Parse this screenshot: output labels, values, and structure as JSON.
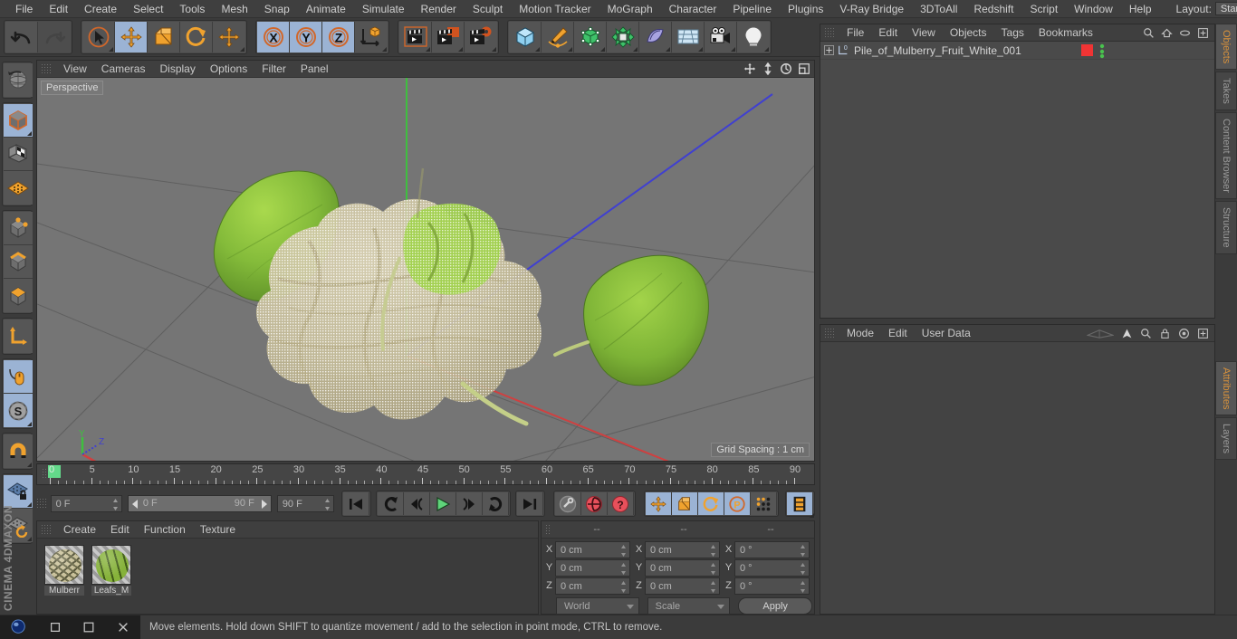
{
  "menubar": {
    "items": [
      "File",
      "Edit",
      "Create",
      "Select",
      "Tools",
      "Mesh",
      "Snap",
      "Animate",
      "Simulate",
      "Render",
      "Sculpt",
      "Motion Tracker",
      "MoGraph",
      "Character",
      "Pipeline",
      "Plugins",
      "V-Ray Bridge",
      "3DToAll",
      "Redshift",
      "Script",
      "Window",
      "Help"
    ],
    "layout_label": "Layout:",
    "layout_value": "Startup"
  },
  "toolbar": {
    "groups": [
      {
        "name": "undo-redo",
        "buttons": [
          {
            "icon": "undo-icon",
            "label": "Undo",
            "state": "normal"
          },
          {
            "icon": "redo-icon",
            "label": "Redo",
            "state": "disabled"
          }
        ]
      },
      {
        "name": "transform",
        "buttons": [
          {
            "icon": "select-cursor-icon",
            "label": "Live Selection",
            "state": "normal"
          },
          {
            "icon": "move-icon",
            "label": "Move",
            "state": "active"
          },
          {
            "icon": "scale-icon",
            "label": "Scale",
            "state": "normal"
          },
          {
            "icon": "rotate-icon",
            "label": "Rotate",
            "state": "normal"
          },
          {
            "icon": "move-alt-icon",
            "label": "Move Alt",
            "state": "normal"
          }
        ]
      },
      {
        "name": "axis-lock",
        "buttons": [
          {
            "icon": "axis-x-icon",
            "label": "X Axis",
            "state": "active"
          },
          {
            "icon": "axis-y-icon",
            "label": "Y Axis",
            "state": "active"
          },
          {
            "icon": "axis-z-icon",
            "label": "Z Axis",
            "state": "active"
          },
          {
            "icon": "world-coord-icon",
            "label": "World/Object Coordinates",
            "state": "normal"
          }
        ]
      },
      {
        "name": "render",
        "buttons": [
          {
            "icon": "render-view-icon",
            "label": "Render View",
            "state": "normal"
          },
          {
            "icon": "render-picture-viewer-icon",
            "label": "Render to Picture Viewer",
            "state": "normal"
          },
          {
            "icon": "render-settings-icon",
            "label": "Edit Render Settings",
            "state": "normal"
          }
        ]
      },
      {
        "name": "create",
        "buttons": [
          {
            "icon": "cube-primitive-icon",
            "label": "Add Cube Object",
            "state": "normal"
          },
          {
            "icon": "pen-spline-icon",
            "label": "Add Spline",
            "state": "normal"
          },
          {
            "icon": "generator-icon",
            "label": "Add Generator",
            "state": "normal"
          },
          {
            "icon": "deformer-icon",
            "label": "Add Deformer",
            "state": "normal"
          },
          {
            "icon": "scene-object-icon",
            "label": "Add Scene Object",
            "state": "normal"
          },
          {
            "icon": "environment-icon",
            "label": "Add Environment",
            "state": "normal"
          },
          {
            "icon": "camera-icon",
            "label": "Add Camera",
            "state": "normal"
          },
          {
            "icon": "light-icon",
            "label": "Add Light",
            "state": "normal"
          }
        ]
      }
    ]
  },
  "lefttools": {
    "groups": [
      {
        "buttons": [
          {
            "icon": "undo-view-icon",
            "label": "Undo View",
            "state": "normal"
          }
        ]
      },
      {
        "buttons": [
          {
            "icon": "object-mode-icon",
            "label": "Model Mode",
            "state": "active"
          },
          {
            "icon": "texture-mode-icon",
            "label": "Texture Mode",
            "state": "normal"
          },
          {
            "icon": "workplane-icon",
            "label": "Workplane",
            "state": "normal"
          }
        ]
      },
      {
        "buttons": [
          {
            "icon": "points-mode-icon",
            "label": "Points",
            "state": "normal"
          },
          {
            "icon": "edges-mode-icon",
            "label": "Edges",
            "state": "normal"
          },
          {
            "icon": "polygons-mode-icon",
            "label": "Polygons",
            "state": "normal"
          }
        ]
      },
      {
        "buttons": [
          {
            "icon": "axis-modify-icon",
            "label": "Enable Axis Modification",
            "state": "normal"
          }
        ]
      },
      {
        "buttons": [
          {
            "icon": "viewport-solo-icon",
            "label": "Viewport Solo",
            "state": "active"
          },
          {
            "icon": "soft-selection-icon",
            "label": "Soft Selection",
            "state": "active"
          }
        ]
      },
      {
        "buttons": [
          {
            "icon": "snap-magnet-icon",
            "label": "Enable Snapping",
            "state": "normal"
          }
        ]
      },
      {
        "buttons": [
          {
            "icon": "workplane-lock-icon",
            "label": "Lock Workplane",
            "state": "active"
          },
          {
            "icon": "planar-workplane-icon",
            "label": "Planar Workplane",
            "state": "normal"
          }
        ]
      }
    ],
    "brand_line1": "MAXON",
    "brand_line2": "CINEMA 4D"
  },
  "viewport": {
    "menu": [
      "View",
      "Cameras",
      "Display",
      "Options",
      "Filter",
      "Panel"
    ],
    "camera_label": "Perspective",
    "grid_spacing": "Grid Spacing : 1 cm",
    "axis_gizmo": {
      "x": "X",
      "y": "Y",
      "z": "Z"
    },
    "corner_icons": [
      "viewport-move-icon",
      "viewport-zoom-icon",
      "viewport-rotate-icon",
      "viewport-maximize-icon"
    ],
    "colors": {
      "background": "#757575",
      "x_axis": "#d04040",
      "y_axis": "#3fbf3f",
      "z_axis": "#4040d0"
    }
  },
  "timeline": {
    "ticks": [
      0,
      5,
      10,
      15,
      20,
      25,
      30,
      35,
      40,
      45,
      50,
      55,
      60,
      65,
      70,
      75,
      80,
      85,
      90
    ],
    "current_frame_marker": 0,
    "end_field": "0 F",
    "start_frame": "0 F",
    "preview_min": "0 F",
    "preview_max": "90 F",
    "end_frame": "90 F",
    "transport_buttons": [
      {
        "icon": "go-to-start-icon",
        "label": "Go to Start",
        "state": "normal"
      },
      {
        "icon": "previous-key-icon",
        "label": "Go to Previous Key",
        "state": "normal"
      },
      {
        "icon": "previous-frame-icon",
        "label": "Go to Previous Frame",
        "state": "normal"
      },
      {
        "icon": "play-icon",
        "label": "Play Forwards",
        "state": "normal"
      },
      {
        "icon": "next-frame-icon",
        "label": "Go to Next Frame",
        "state": "normal"
      },
      {
        "icon": "next-key-icon",
        "label": "Go to Next Key",
        "state": "normal"
      },
      {
        "icon": "go-to-end-icon",
        "label": "Go to End",
        "state": "normal"
      }
    ],
    "record_buttons": [
      {
        "icon": "record-key-icon",
        "label": "Record Active Objects",
        "state": "disabled"
      },
      {
        "icon": "autokey-icon",
        "label": "Autokeying",
        "state": "normal"
      },
      {
        "icon": "keyframe-selection-icon",
        "label": "Keyframe Selection",
        "state": "normal"
      }
    ],
    "key_toggle_buttons": [
      {
        "icon": "key-position-icon",
        "label": "Position",
        "state": "active"
      },
      {
        "icon": "key-scale-icon",
        "label": "Scale",
        "state": "active"
      },
      {
        "icon": "key-rotation-icon",
        "label": "Rotation",
        "state": "active"
      },
      {
        "icon": "key-pla-icon",
        "label": "Point Level Animation",
        "state": "active"
      },
      {
        "icon": "key-param-icon",
        "label": "Parameter",
        "state": "normal"
      }
    ],
    "extra_button": {
      "icon": "timeline-strip-icon",
      "label": "Animation Mode",
      "state": "active"
    }
  },
  "material_manager": {
    "menu": [
      "Create",
      "Edit",
      "Function",
      "Texture"
    ],
    "materials": [
      {
        "name": "Mulberr",
        "full_name": "Mulberry",
        "color": "#c9c19a"
      },
      {
        "name": "Leafs_M",
        "full_name": "Leafs_Mat",
        "color": "#86b23a"
      }
    ]
  },
  "coordinates": {
    "headers": [
      "--",
      "--",
      "--"
    ],
    "rows": [
      {
        "axis": "X",
        "position": "0 cm",
        "size": "0 cm",
        "rotation": "0 °"
      },
      {
        "axis": "Y",
        "position": "0 cm",
        "size": "0 cm",
        "rotation": "0 °"
      },
      {
        "axis": "Z",
        "position": "0 cm",
        "size": "0 cm",
        "rotation": "0 °"
      }
    ],
    "coord_system": "World",
    "size_mode": "Scale",
    "apply_label": "Apply"
  },
  "object_manager": {
    "menu": [
      "File",
      "Edit",
      "View",
      "Objects",
      "Tags",
      "Bookmarks"
    ],
    "header_icons": [
      "search-icon",
      "home-icon",
      "link-icon",
      "plus-icon"
    ],
    "objects": [
      {
        "name": "Pile_of_Mulberry_Fruit_White_001",
        "icon": "null-object-icon",
        "tag_color": "#f03434",
        "dots": "visibility-dots"
      }
    ]
  },
  "attribute_manager": {
    "menu": [
      "Mode",
      "Edit",
      "User Data"
    ],
    "header_icons": [
      "flatten-icon",
      "pin-arrow-icon",
      "search-icon",
      "lock-icon",
      "target-icon",
      "plus-icon"
    ]
  },
  "right_tabs": [
    {
      "label": "Objects",
      "selected": true
    },
    {
      "label": "Takes",
      "selected": false
    },
    {
      "label": "Content Browser",
      "selected": false
    },
    {
      "label": "Structure",
      "selected": false
    },
    {
      "label": "Attributes",
      "selected": true
    },
    {
      "label": "Layers",
      "selected": false
    }
  ],
  "statusbar": {
    "message": "Move elements. Hold down SHIFT to quantize movement / add to the selection in point mode, CTRL to remove.",
    "taskbar_icons": [
      "app-icon",
      "restore-icon",
      "minimize-icon",
      "close-icon"
    ]
  }
}
